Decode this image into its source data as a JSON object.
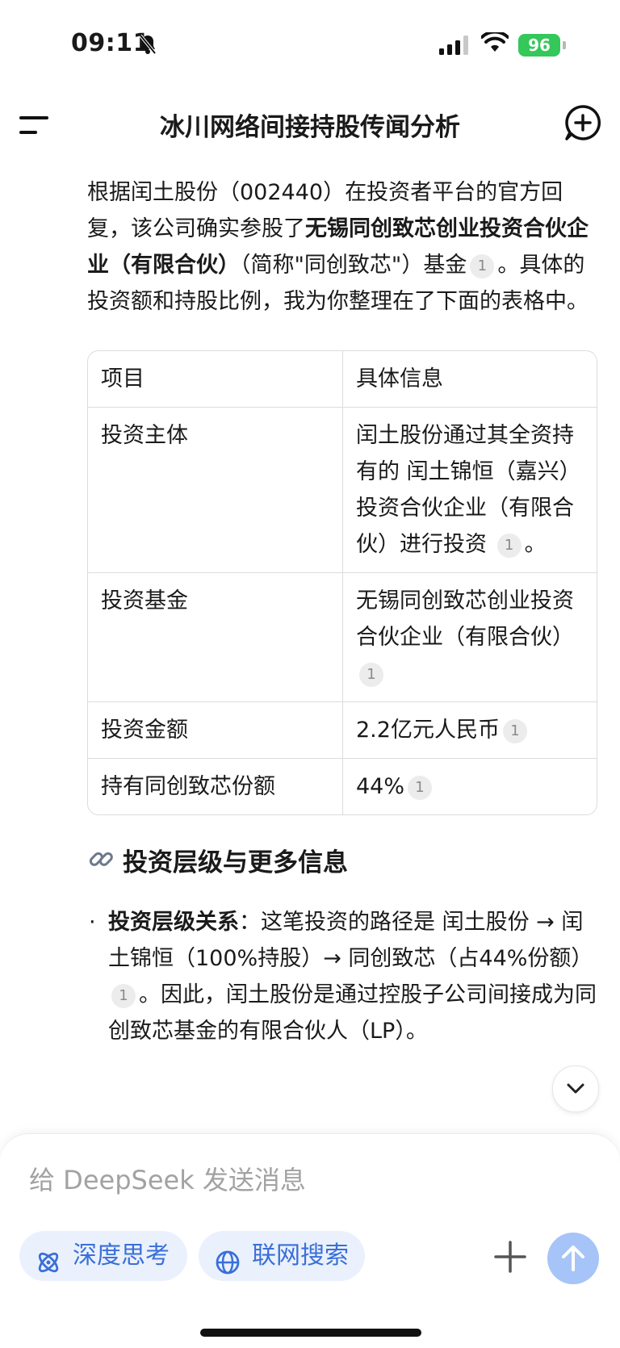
{
  "status_bar": {
    "time": "09:11",
    "battery": "96"
  },
  "header": {
    "title": "冰川网络间接持股传闻分析"
  },
  "message": {
    "intro_pre": "根据闰土股份（002440）在投资者平台的官方回复，该公司确实参股了",
    "intro_bold": "无锡同创致芯创业投资合伙企业（有限合伙）",
    "intro_post": "（简称\"同创致芯\"）基金",
    "intro_cite": "1",
    "intro_end": "。具体的投资额和持股比例，我为你整理在了下面的表格中。"
  },
  "table": {
    "headers": [
      "项目",
      "具体信息"
    ],
    "rows": [
      {
        "item": "投资主体",
        "info": "闰土股份通过其全资持有的 闰土锦恒（嘉兴）投资合伙企业（有限合伙）进行投资",
        "cite": "1",
        "tail": "。"
      },
      {
        "item": "投资基金",
        "info": "无锡同创致芯创业投资合伙企业（有限合伙）",
        "cite": "1",
        "tail": ""
      },
      {
        "item": "投资金额",
        "info": "2.2亿元人民币",
        "cite": "1",
        "tail": ""
      },
      {
        "item": "持有同创致芯份额",
        "info": "44%",
        "cite": "1",
        "tail": ""
      }
    ]
  },
  "section": {
    "icon": "link-icon",
    "title": "投资层级与更多信息"
  },
  "bullets": [
    {
      "bold": "投资层级关系",
      "text_a": "：这笔投资的路径是 闰土股份 → 闰土锦恒（100%持股）→ 同创致芯（占44%份额）",
      "cite": "1",
      "text_b": "。因此，闰土股份是通过控股子公司间接成为同创致芯基金的有限合伙人（LP）。"
    }
  ],
  "composer": {
    "placeholder": "给 DeepSeek 发送消息",
    "deep_think": "深度思考",
    "web_search": "联网搜索"
  },
  "colors": {
    "accent": "#3a6fd8",
    "pill_bg": "#eaf1fd",
    "send_bg": "#a6c4f7",
    "battery": "#34c759"
  }
}
